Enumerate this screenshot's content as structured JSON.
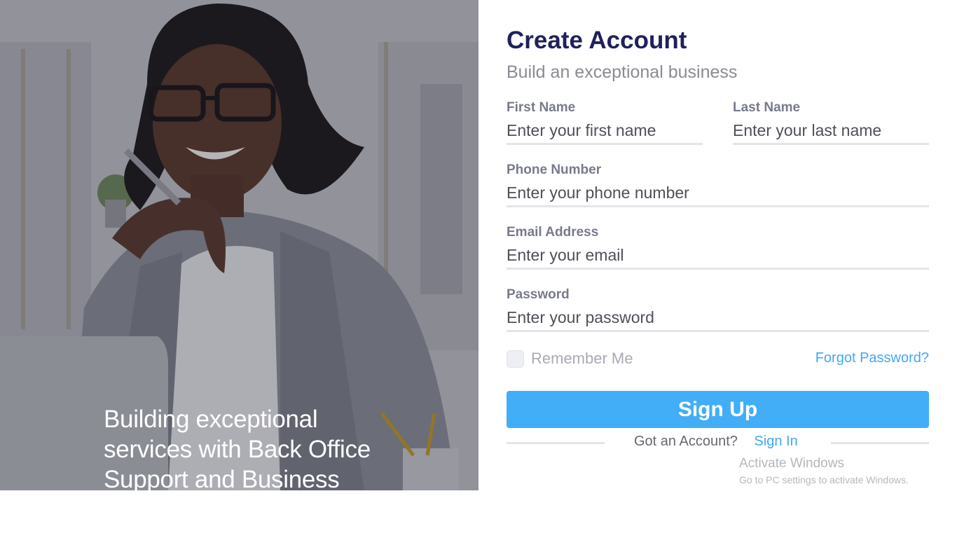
{
  "hero": {
    "caption": "Building exceptional services with Back Office Support and Business"
  },
  "form": {
    "title": "Create Account",
    "subtitle": "Build an exceptional business",
    "first_name": {
      "label": "First Name",
      "placeholder": "Enter your first name",
      "value": ""
    },
    "last_name": {
      "label": "Last Name",
      "placeholder": "Enter your last name",
      "value": ""
    },
    "phone": {
      "label": "Phone Number",
      "placeholder": "Enter your phone number",
      "value": ""
    },
    "email": {
      "label": "Email Address",
      "placeholder": "Enter your email",
      "value": ""
    },
    "password": {
      "label": "Password",
      "placeholder": "Enter your password",
      "value": ""
    },
    "remember_label": "Remember Me",
    "remember_checked": false,
    "forgot_label": "Forgot Password?",
    "submit_label": "Sign Up",
    "account_prompt": "Got an Account?",
    "signin_label": "Sign In"
  },
  "watermark": {
    "title": "Activate Windows",
    "subtitle": "Go to PC settings to activate Windows."
  },
  "colors": {
    "title": "#21205c",
    "accent": "#41aef7",
    "link": "#42a8f4",
    "label": "#787a8c"
  },
  "icons": [
    "hero-photo-image",
    "checkbox-icon"
  ]
}
